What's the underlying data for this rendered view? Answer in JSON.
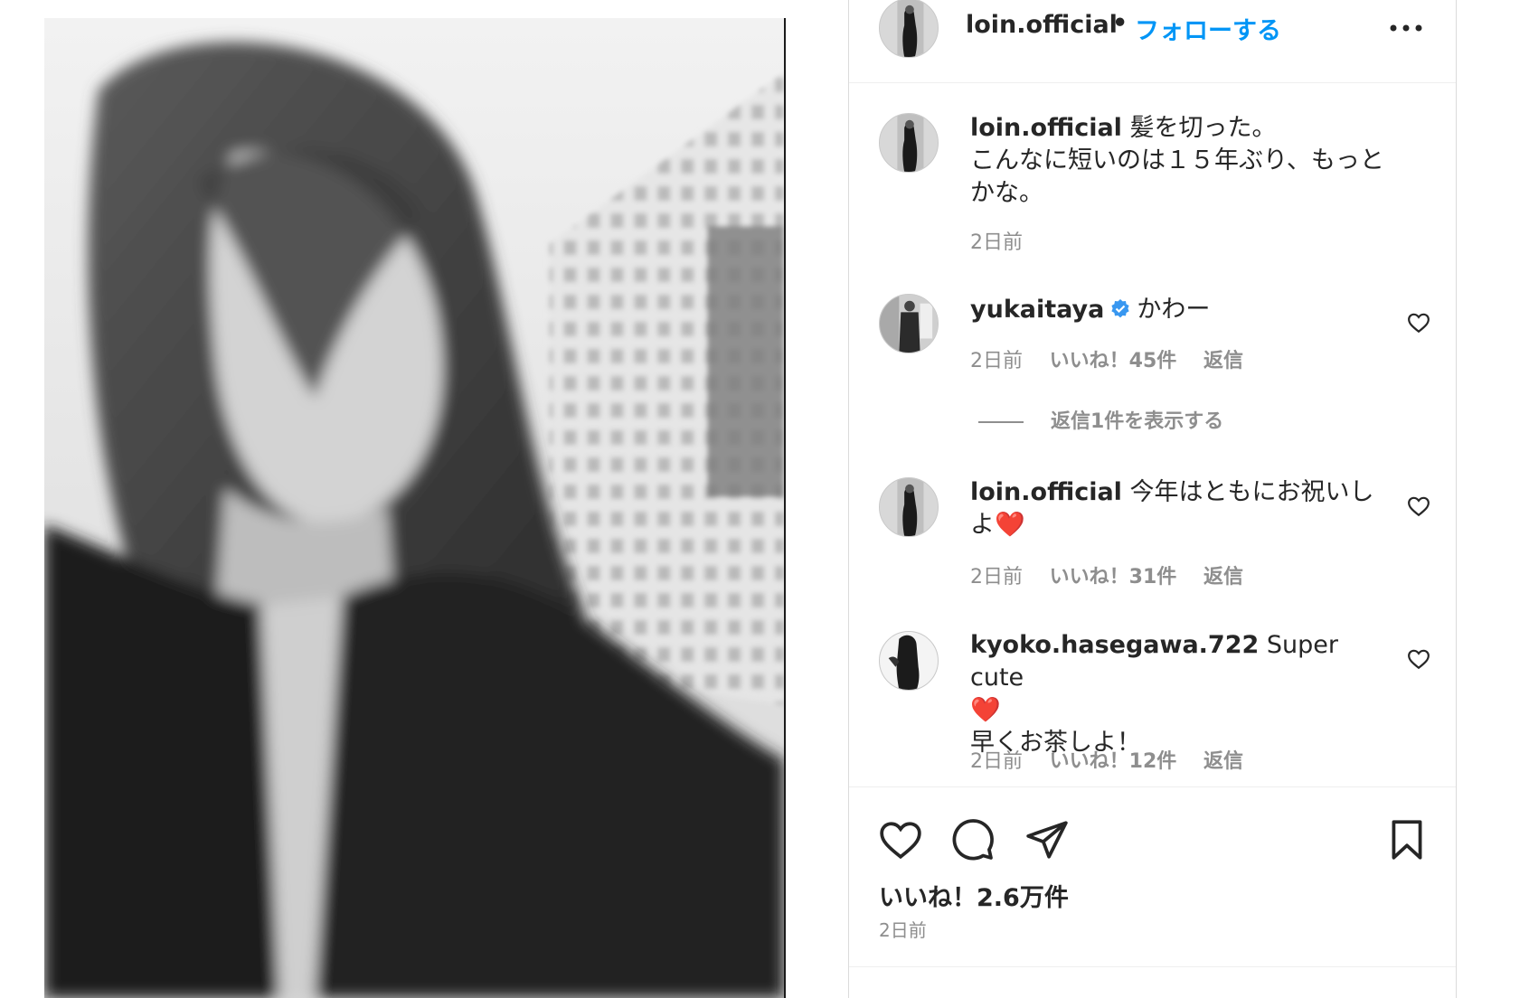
{
  "post": {
    "username": "loin.official",
    "dot": "•",
    "follow_label": "フォローする",
    "caption_line1": "髪を切った。",
    "caption_line2": "こんなに短いのは１５年ぶり、もっとかな。",
    "caption_time": "2日前"
  },
  "comments": [
    {
      "username": "yukaitaya",
      "verified": true,
      "text": "かわー",
      "time": "2日前",
      "likes": "いいね！45件",
      "reply": "返信",
      "view_replies": "返信1件を表示する"
    },
    {
      "username": "loin.official",
      "text": "今年はともにお祝いしよ",
      "emoji": "❤️",
      "time": "2日前",
      "likes": "いいね！31件",
      "reply": "返信"
    },
    {
      "username": "kyoko.hasegawa.722",
      "text": "Super cute",
      "emoji": "❤️",
      "text2": "早くお茶しよ！",
      "time": "2日前",
      "likes": "いいね！12件",
      "reply": "返信"
    }
  ],
  "footer": {
    "likes_total": "いいね！2.6万件",
    "time": "2日前"
  },
  "icons": {
    "more": "more-horizontal-icon",
    "like": "heart-icon",
    "comment": "comment-icon",
    "share": "paper-plane-icon",
    "save": "bookmark-icon",
    "verified": "verified-badge-icon"
  },
  "colors": {
    "follow_blue": "#0095f6",
    "verified_blue": "#3897f0",
    "muted_text": "#8e8e8e",
    "heart_red": "#e0243a"
  }
}
